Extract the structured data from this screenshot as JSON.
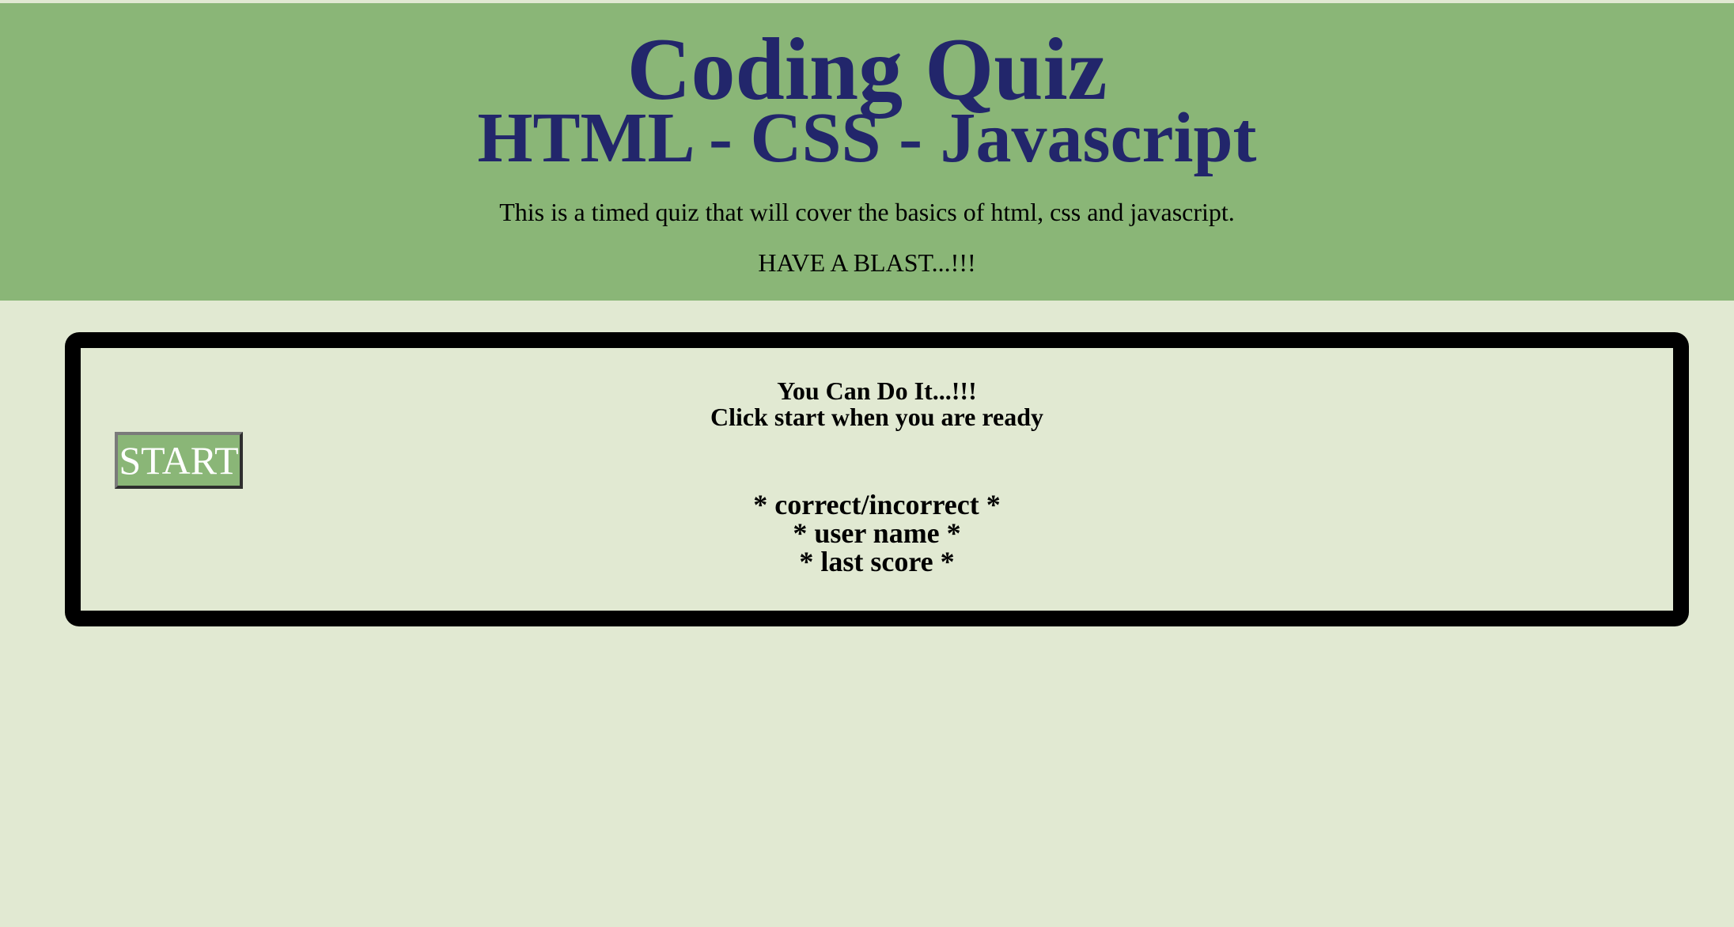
{
  "header": {
    "title": "Coding Quiz",
    "subtitle": "HTML - CSS - Javascript",
    "description": "This is a timed quiz that will cover the basics of html, css and javascript.",
    "tagline": "HAVE A BLAST...!!!"
  },
  "quiz": {
    "start_label": "START",
    "encourage_line1": "You Can Do It...!!!",
    "encourage_line2": "Click start when you are ready",
    "result": "* correct/incorrect *",
    "user_name": "* user name *",
    "last_score": "* last score *"
  },
  "colors": {
    "header_bg": "#8ab677",
    "page_bg": "#e1e9d2",
    "title_color": "#22266b",
    "button_bg": "#8ab677",
    "box_border": "#000000"
  }
}
